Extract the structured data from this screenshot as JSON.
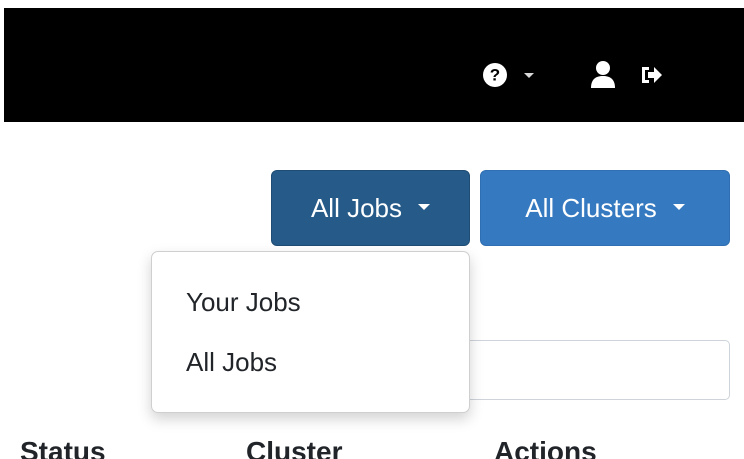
{
  "navbar": {
    "help_icon": "question-circle-icon",
    "help_caret_icon": "caret-down-icon",
    "user_icon": "user-icon",
    "logout_icon": "sign-out-icon"
  },
  "filters": {
    "jobs_button_label": "All Jobs",
    "clusters_button_label": "All Clusters"
  },
  "jobs_dropdown": {
    "items": [
      {
        "label": "Your Jobs"
      },
      {
        "label": "All Jobs"
      }
    ]
  },
  "table": {
    "columns": [
      "Status",
      "Cluster",
      "Actions"
    ]
  },
  "colors": {
    "navbar_bg": "#000000",
    "jobs_button_bg": "#265a88",
    "clusters_button_bg": "#3579c0"
  }
}
